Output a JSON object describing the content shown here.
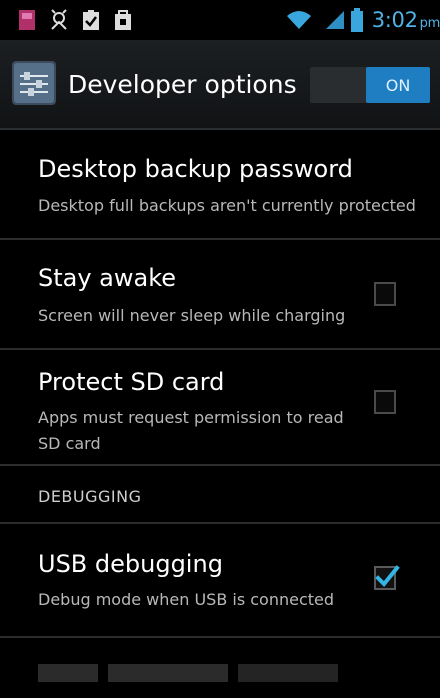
{
  "status_bar": {
    "time": "3:02",
    "ampm": "pm"
  },
  "action_bar": {
    "title": "Developer options",
    "switch_label": "ON",
    "icon": "developer-settings-icon"
  },
  "items": [
    {
      "title": "Desktop backup password",
      "subtitle_lines": [
        "Desktop full backups aren't currently protected"
      ],
      "has_checkbox": false
    },
    {
      "title": "Stay awake",
      "subtitle_lines": [
        "Screen will never sleep while charging"
      ],
      "has_checkbox": true,
      "checked": false
    },
    {
      "title": "Protect SD card",
      "subtitle_lines": [
        "Apps must request permission to read",
        "SD card"
      ],
      "has_checkbox": true,
      "checked": false
    }
  ],
  "section": {
    "label": "DEBUGGING"
  },
  "debug_items": [
    {
      "title": "USB debugging",
      "subtitle_lines": [
        "Debug mode when USB is connected"
      ],
      "has_checkbox": true,
      "checked": true
    }
  ],
  "colors": {
    "accent": "#33b5e5",
    "switch_on": "#1f7ec2",
    "background": "#000000"
  }
}
